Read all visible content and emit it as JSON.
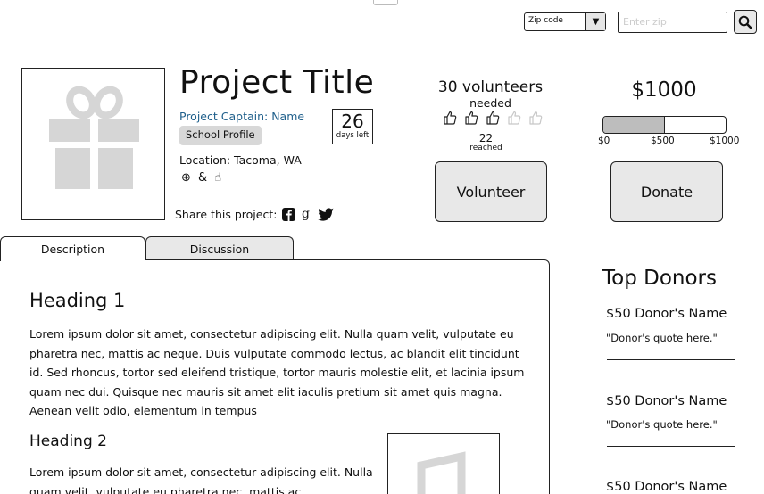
{
  "header": {
    "zip_select_value": "Zip code",
    "zip_placeholder": "Enter zip"
  },
  "project": {
    "title": "Project Title",
    "captain": "Project Captain: Name",
    "school_profile_label": "School Profile",
    "days_number": "26",
    "days_label": "days left",
    "location": "Location: Tacoma, WA",
    "location_icons": "⊕ & ☝",
    "share_label": "Share this project:"
  },
  "volunteers": {
    "count_text": "30 volunteers",
    "needed_label": "needed",
    "reached_number": "22",
    "reached_label": "reached",
    "filled_thumbs": 3,
    "total_thumbs": 5,
    "button_label": "Volunteer"
  },
  "donation": {
    "amount": "$1000",
    "progress_fraction": 0.5,
    "progress_labels": [
      "$0",
      "$500",
      "$1000"
    ],
    "button_label": "Donate"
  },
  "tabs": [
    {
      "label": "Description",
      "active": true
    },
    {
      "label": "Discussion",
      "active": false
    }
  ],
  "content": {
    "heading1": "Heading 1",
    "paragraph1": "Lorem ipsum dolor sit amet, consectetur adipiscing elit. Nulla quam velit, vulputate eu pharetra nec, mattis ac neque. Duis vulputate commodo lectus, ac blandit elit tincidunt id. Sed rhoncus, tortor sed eleifend tristique, tortor mauris molestie elit, et lacinia ipsum quam nec dui. Quisque nec mauris sit amet elit iaculis pretium sit amet quis magna. Aenean velit odio, elementum in tempus",
    "heading2": "Heading 2",
    "paragraph2": "Lorem ipsum dolor sit amet, consectetur adipiscing elit. Nulla quam velit, vulputate eu pharetra nec, mattis ac"
  },
  "top_donors": {
    "title": "Top Donors",
    "donors": [
      {
        "amount_name": "$50 Donor's Name",
        "quote": "\"Donor's quote here.\""
      },
      {
        "amount_name": "$50 Donor's Name",
        "quote": "\"Donor's quote here.\""
      },
      {
        "amount_name": "$50 Donor's Name",
        "quote": ""
      }
    ]
  },
  "colors": {
    "accent_link": "#1f5f8b",
    "button_fill": "#e8e8e8",
    "progress_fill": "#bdbdbd",
    "placeholder_image": "#d6d6d6"
  }
}
